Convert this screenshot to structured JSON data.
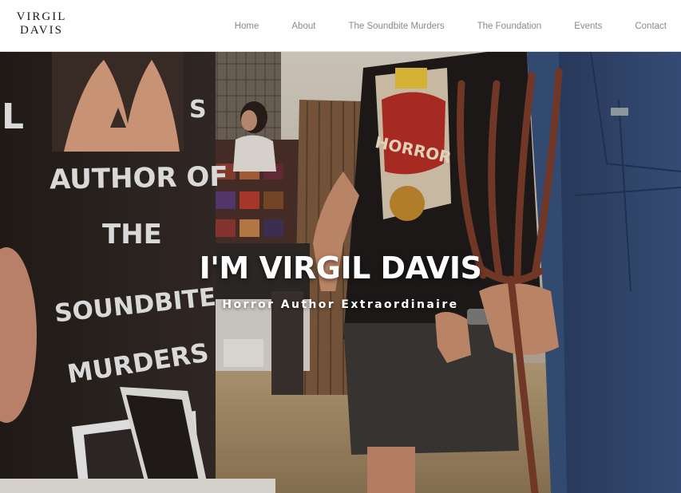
{
  "site": {
    "logo_line1": "VIRGIL",
    "logo_line2": "DAVIS"
  },
  "nav": {
    "items": [
      {
        "label": "Home"
      },
      {
        "label": "About"
      },
      {
        "label": "The Soundbite Murders"
      },
      {
        "label": "The Foundation"
      },
      {
        "label": "Events"
      },
      {
        "label": "Contact"
      }
    ]
  },
  "hero": {
    "title": "I'M VIRGIL DAVIS",
    "subtitle": "Horror Author Extraordinaire",
    "banner": {
      "line_author_of": "AUTHOR OF",
      "line_the": "THE",
      "line_soundbite": "SOUNDBITE",
      "line_murders": "MURDERS",
      "letter_left": "L",
      "letter_right": "S"
    },
    "shirt_text": "HORROR"
  },
  "colors": {
    "nav_text": "#8a8a8a",
    "logo_text": "#1a1a1a",
    "hero_text": "#ffffff",
    "banner_bg": "#2b2522",
    "pitchfork": "#7a3b2a"
  }
}
